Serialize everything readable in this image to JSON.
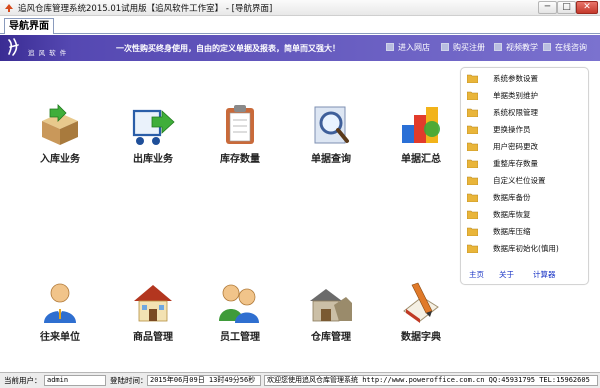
{
  "window": {
    "title": "追风仓库管理系统2015.01试用版【追风软件工作室】 - [导航界面]",
    "minimize": "─",
    "maximize": "□",
    "close": "✕"
  },
  "tab": {
    "label": "导航界面"
  },
  "banner": {
    "logo_text": "追 风 软 件",
    "slogan": "一次性购买终身使用，自由的定义单据及报表，简单而又强大！",
    "links": [
      "进入网店",
      "购买注册",
      "视频教学",
      "在线咨询"
    ]
  },
  "tiles": [
    {
      "label": "入库业务",
      "icon": "inbound-box-icon"
    },
    {
      "label": "出库业务",
      "icon": "outbound-cart-icon"
    },
    {
      "label": "库存数量",
      "icon": "clipboard-icon"
    },
    {
      "label": "单据查询",
      "icon": "magnifier-icon"
    },
    {
      "label": "单据汇总",
      "icon": "chart-cubes-icon"
    },
    {
      "label": "往来单位",
      "icon": "contact-person-icon"
    },
    {
      "label": "商品管理",
      "icon": "house-icon"
    },
    {
      "label": "员工管理",
      "icon": "staff-people-icon"
    },
    {
      "label": "仓库管理",
      "icon": "warehouse-icon"
    },
    {
      "label": "数据字典",
      "icon": "dictionary-book-icon"
    }
  ],
  "panel": {
    "items": [
      "系统参数设置",
      "单据类别维护",
      "系统权限管理",
      "更换操作员",
      "用户密码更改",
      "重整库存数量",
      "自定义栏位设置",
      "数据库备份",
      "数据库恢复",
      "数据库压缩",
      "数据库初始化(慎用)"
    ],
    "links": [
      "主页",
      "关于",
      "计算器"
    ]
  },
  "status": {
    "user_label": "当前用户：",
    "user_value": "admin",
    "login_label": "登陆时间：",
    "login_value": "2015年06月09日 13时49分56秒",
    "welcome": "欢迎您使用追风仓库管理系统 http://www.poweroffice.com.cn QQ:45931795 TEL:15962605"
  },
  "colors": {
    "banner_start": "#3a2c93",
    "banner_end": "#7b72cf",
    "link_blue": "#1a35c6"
  }
}
